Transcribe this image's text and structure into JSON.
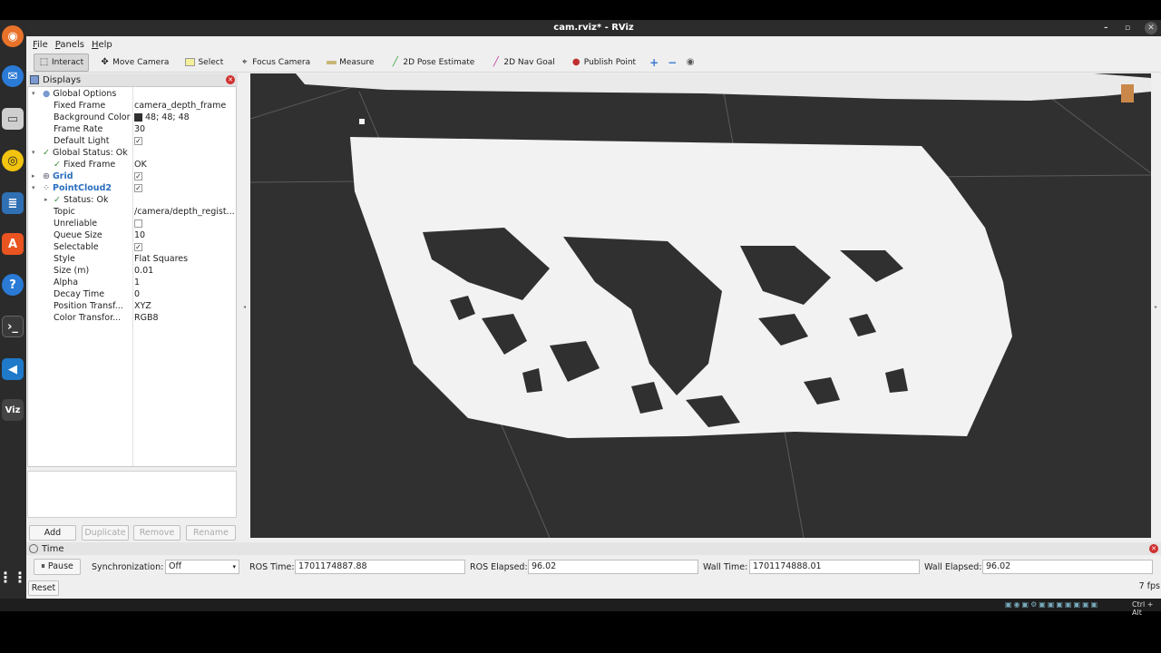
{
  "window": {
    "title": "cam.rviz* - RViz",
    "minimize": "–",
    "restore": "▫",
    "close": "✕"
  },
  "menu": [
    "File",
    "Panels",
    "Help"
  ],
  "menu_mnemonic": [
    "F",
    "P",
    "H"
  ],
  "menu_rest": [
    "ile",
    "anels",
    "elp"
  ],
  "toolbar": {
    "interact": "Interact",
    "move_camera": "Move Camera",
    "select": "Select",
    "focus_camera": "Focus Camera",
    "measure": "Measure",
    "pose_estimate": "2D Pose Estimate",
    "nav_goal": "2D Nav Goal",
    "publish_point": "Publish Point",
    "plus": "+",
    "minus": "−"
  },
  "displays": {
    "title": "Displays",
    "rows": [
      {
        "label": "Global Options",
        "value": ""
      },
      {
        "label": "Fixed Frame",
        "value": "camera_depth_frame"
      },
      {
        "label": "Background Color",
        "value": "48; 48; 48"
      },
      {
        "label": "Frame Rate",
        "value": "30"
      },
      {
        "label": "Default Light",
        "value": "✓"
      },
      {
        "label": "Global Status: Ok",
        "value": ""
      },
      {
        "label": "Fixed Frame",
        "value": "OK"
      },
      {
        "label": "Grid",
        "value": "✓"
      },
      {
        "label": "PointCloud2",
        "value": "✓"
      },
      {
        "label": "Status: Ok",
        "value": ""
      },
      {
        "label": "Topic",
        "value": "/camera/depth_regist..."
      },
      {
        "label": "Unreliable",
        "value": ""
      },
      {
        "label": "Queue Size",
        "value": "10"
      },
      {
        "label": "Selectable",
        "value": "✓"
      },
      {
        "label": "Style",
        "value": "Flat Squares"
      },
      {
        "label": "Size (m)",
        "value": "0.01"
      },
      {
        "label": "Alpha",
        "value": "1"
      },
      {
        "label": "Decay Time",
        "value": "0"
      },
      {
        "label": "Position Transf...",
        "value": "XYZ"
      },
      {
        "label": "Color Transfor...",
        "value": "RGB8"
      }
    ],
    "buttons": {
      "add": "Add",
      "duplicate": "Duplicate",
      "remove": "Remove",
      "rename": "Rename"
    }
  },
  "time": {
    "title": "Time",
    "pause": "Pause",
    "sync_label": "Synchronization:",
    "sync_value": "Off",
    "ros_time_label": "ROS Time:",
    "ros_time": "1701174887.88",
    "ros_elapsed_label": "ROS Elapsed:",
    "ros_elapsed": "96.02",
    "wall_time_label": "Wall Time:",
    "wall_time": "1701174888.01",
    "wall_elapsed_label": "Wall Elapsed:",
    "wall_elapsed": "96.02",
    "reset": "Reset",
    "fps": "7 fps"
  },
  "dock": {
    "rviz": "Viz",
    "help": "?"
  },
  "system": {
    "shortcut": "Ctrl + Alt"
  },
  "colors": {
    "viewport_bg": "#303030",
    "pointcloud": "#f2f2f2",
    "link": "#2a6fbf"
  }
}
